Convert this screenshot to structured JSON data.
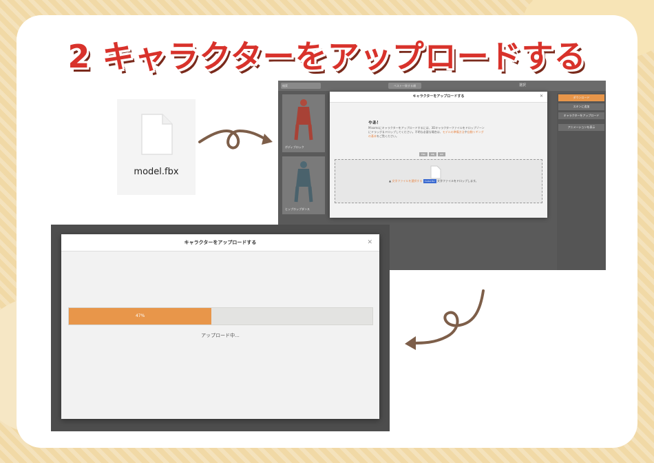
{
  "heading": "2 キャラクターをアップロードする",
  "file_card": {
    "file_name": "model.fbx",
    "icon": "document-icon"
  },
  "screenshot1": {
    "search_placeholder": "検索",
    "sort_label": "ベスト一致する順",
    "panel_title": "選択",
    "tiles": [
      {
        "label": "ボディブロック"
      },
      {
        "label": "ヒップホップダンス"
      }
    ],
    "sidebar_buttons": [
      "ダウンロード",
      "スキンに追加",
      "キャラクターをアップロード",
      "アニメーションを表示"
    ],
    "modal": {
      "title": "キャラクターをアップロードする",
      "greeting": "やあ！",
      "description_before": "Mixamoにキャラクターをアップロードするには、3Dキャラクターファイルをドロップゾーンにドラッグ＆ドロップしてください。不明な必要な場合は、",
      "description_link1": "モデルの準備方法",
      "description_mid": "や",
      "description_link2": "自動リギングの基本",
      "description_after": "をご覧ください。",
      "tags": [
        "FBX",
        "OBJ",
        "ZIP"
      ],
      "drop_text_link": "文字ファイルを選択する",
      "drop_chip": "model.fbx",
      "drop_text_after": "文字ファイルをドロップします。"
    }
  },
  "screenshot2": {
    "modal": {
      "title": "キャラクターをアップロードする",
      "progress_percent": 47,
      "progress_label": "47%",
      "status_text": "アップロード中..."
    }
  },
  "colors": {
    "accent": "#e8964a",
    "heading_red": "#d8322b",
    "arrow": "#7d5e49"
  }
}
